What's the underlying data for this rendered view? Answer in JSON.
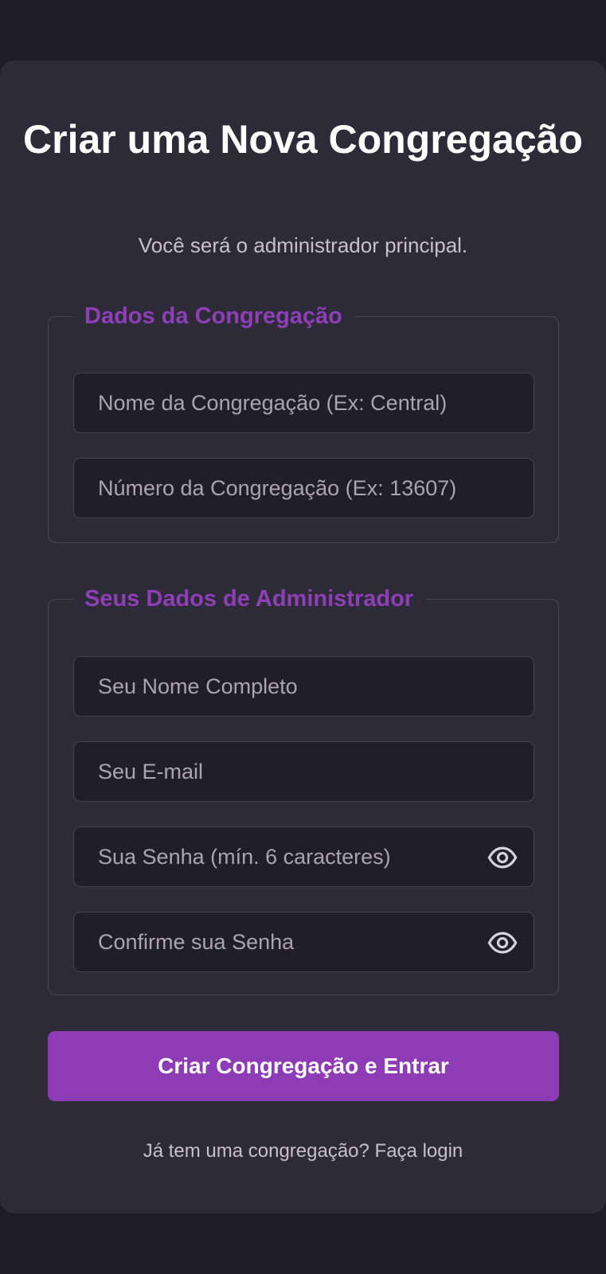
{
  "header": {
    "title": "Criar uma Nova Congregação",
    "subtitle": "Você será o administrador principal."
  },
  "congregation_section": {
    "legend": "Dados da Congregação",
    "name_placeholder": "Nome da Congregação (Ex: Central)",
    "number_placeholder": "Número da Congregação (Ex: 13607)"
  },
  "admin_section": {
    "legend": "Seus Dados de Administrador",
    "fullname_placeholder": "Seu Nome Completo",
    "email_placeholder": "Seu E-mail",
    "password_placeholder": "Sua Senha (mín. 6 caracteres)",
    "confirm_placeholder": "Confirme sua Senha"
  },
  "actions": {
    "submit_label": "Criar Congregação e Entrar",
    "login_link": "Já tem uma congregação? Faça login"
  },
  "icons": {
    "password_toggle": "eye-icon",
    "confirm_toggle": "eye-icon"
  },
  "colors": {
    "page_background": "#1e1c27",
    "card_background": "#2e2b38",
    "accent": "#8e3cb6",
    "input_background": "#201e2a"
  }
}
